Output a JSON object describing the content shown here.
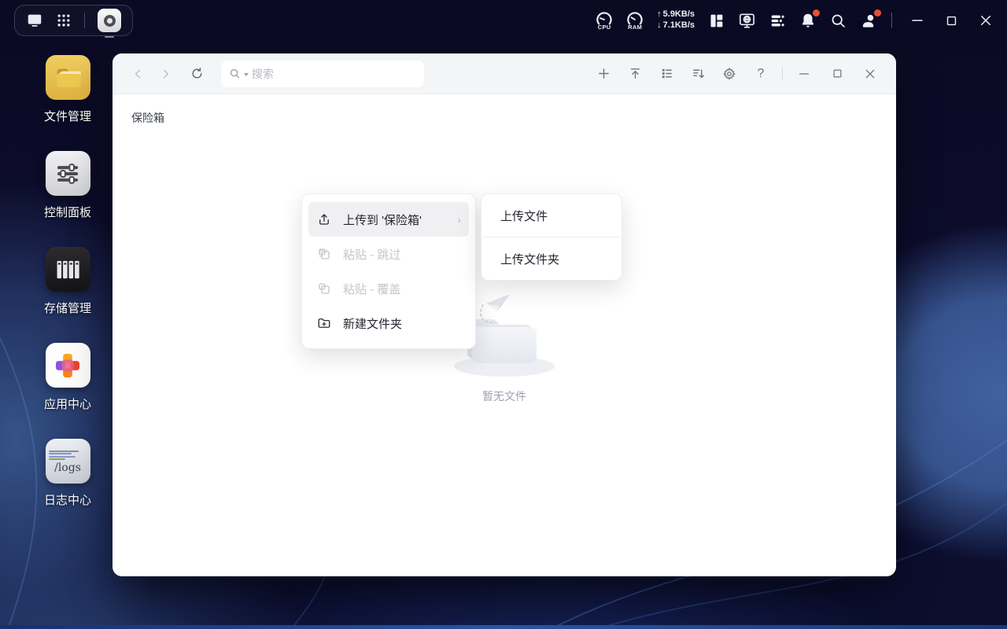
{
  "topbar": {
    "cpu_label": "CPU",
    "ram_label": "RAM",
    "net_up_arrow": "↑",
    "net_down_arrow": "↓",
    "net_up": "5.9KB/s",
    "net_down": "7.1KB/s"
  },
  "desktop": {
    "icons": [
      {
        "label": "文件管理"
      },
      {
        "label": "控制面板"
      },
      {
        "label": "存储管理"
      },
      {
        "label": "应用中心"
      },
      {
        "label": "日志中心",
        "icon_text": "/logs"
      }
    ]
  },
  "window": {
    "search_placeholder": "搜索",
    "help_label": "?",
    "breadcrumb": "保险箱",
    "empty_text": "暂无文件"
  },
  "context_menu": {
    "items": [
      {
        "label": "上传到 '保险箱'",
        "state": "active",
        "chevron": "›"
      },
      {
        "label": "粘贴 - 跳过",
        "state": "disabled"
      },
      {
        "label": "粘贴 - 覆盖",
        "state": "disabled"
      },
      {
        "label": "新建文件夹",
        "state": "normal"
      }
    ]
  },
  "submenu": {
    "items": [
      {
        "label": "上传文件"
      },
      {
        "label": "上传文件夹"
      }
    ]
  },
  "colors": {
    "accent_blue": "#36538d",
    "badge_red": "#e8502f",
    "window_bg": "#ffffff",
    "header_bg": "#f4f5f7",
    "desktop_bg": "#0b0b28"
  }
}
